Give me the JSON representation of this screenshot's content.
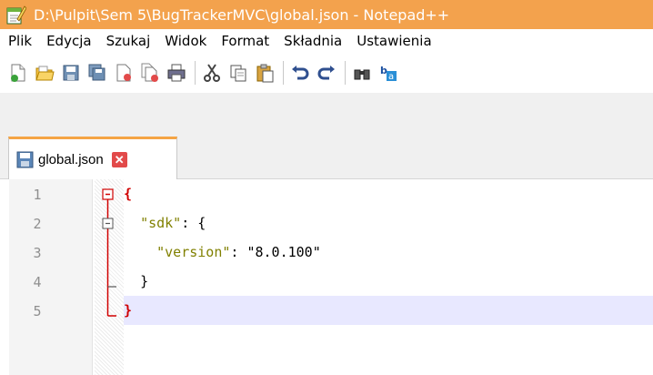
{
  "window": {
    "title": "D:\\Pulpit\\Sem 5\\BugTrackerMVC\\global.json - Notepad++",
    "accent_color": "#f3a24d"
  },
  "menu": {
    "items": [
      "Plik",
      "Edycja",
      "Szukaj",
      "Widok",
      "Format",
      "Składnia",
      "Ustawienia"
    ]
  },
  "toolbar": {
    "icons": [
      "new-file-icon",
      "open-file-icon",
      "save-icon",
      "save-all-icon",
      "close-icon",
      "close-all-icon",
      "print-icon",
      "cut-icon",
      "copy-icon",
      "paste-icon",
      "undo-icon",
      "redo-icon",
      "find-icon",
      "replace-icon"
    ]
  },
  "tabs": [
    {
      "label": "global.json",
      "active": true
    }
  ],
  "editor": {
    "line_numbers": [
      "1",
      "2",
      "3",
      "4",
      "5"
    ],
    "lines": [
      {
        "brace_open": "{"
      },
      {
        "key": "\"sdk\"",
        "sep": ": ",
        "brace": "{"
      },
      {
        "key": "\"version\"",
        "sep": ": ",
        "value": "\"8.0.100\""
      },
      {
        "brace_close": "}"
      },
      {
        "brace_end": "}"
      }
    ],
    "current_line": 5
  }
}
